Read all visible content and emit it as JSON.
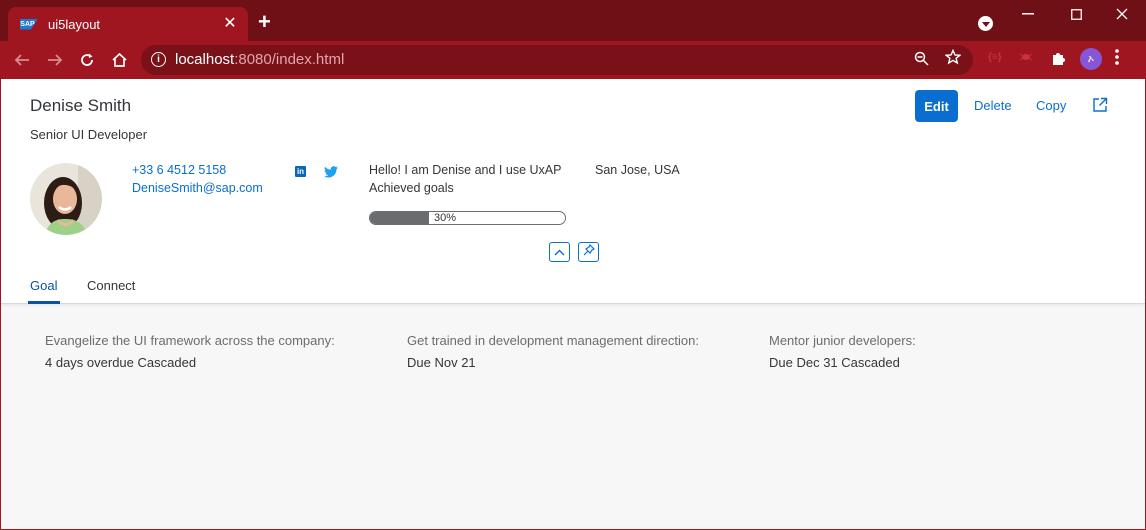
{
  "browser": {
    "tab_title": "ui5layout",
    "sap_logo": "SAP",
    "url_host": "localhost",
    "url_rest": ":8080/index.html",
    "tab_close": "✕",
    "new_tab": "+",
    "profile_initial": "ኦ",
    "window_controls": [
      "—",
      "☐",
      "✕"
    ]
  },
  "header": {
    "name": "Denise Smith",
    "subtitle": "Senior UI Developer",
    "actions": {
      "edit": "Edit",
      "delete": "Delete",
      "copy": "Copy"
    },
    "contact": {
      "phone": "+33 6 4512 5158",
      "email": "DeniseSmith@sap.com",
      "linkedin_letters": "in"
    },
    "intro": "Hello! I am Denise and I use UxAP",
    "location": "San Jose, USA",
    "achieved_label": "Achieved goals",
    "progress": {
      "value": 0.3,
      "label": "30%"
    }
  },
  "tabs": [
    {
      "label": "Goal",
      "selected": true
    },
    {
      "label": "Connect",
      "selected": false
    }
  ],
  "goals": [
    {
      "title": "Evangelize the UI framework across the company:",
      "status": "4 days overdue Cascaded"
    },
    {
      "title": "Get trained in development management direction:",
      "status": "Due Nov 21"
    },
    {
      "title": "Mentor junior developers:",
      "status": "Due Dec 31 Cascaded"
    }
  ],
  "colors": {
    "brand_red": "#9f1620",
    "accent_blue": "#0a6ed1",
    "tab_blue": "#0854a0"
  },
  "icons": [
    "sap-logo-icon",
    "info-icon",
    "zoom-icon",
    "star-icon",
    "puzzle-icon",
    "linkedin-icon",
    "twitter-icon",
    "share-icon",
    "collapse-icon",
    "pin-icon"
  ]
}
